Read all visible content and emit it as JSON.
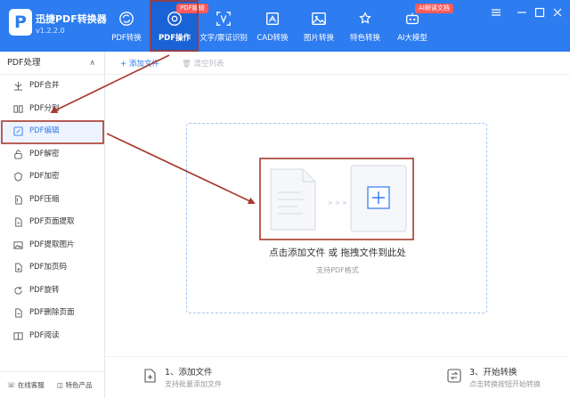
{
  "app": {
    "logo_glyph": "P",
    "name": "迅捷PDF转换器",
    "version": "v1.2.2.0"
  },
  "nav": {
    "tabs": [
      {
        "label": "PDF转换",
        "icon": "refresh-icon",
        "active": false
      },
      {
        "label": "PDF操作",
        "icon": "settings-target-icon",
        "active": true,
        "badge": "PDF编辑"
      },
      {
        "label": "文字/票证识别",
        "icon": "scan-frame-icon",
        "active": false
      },
      {
        "label": "CAD转换",
        "icon": "cad-drawing-icon",
        "active": false
      },
      {
        "label": "图片转换",
        "icon": "image-icon",
        "active": false
      },
      {
        "label": "特色转换",
        "icon": "star-refresh-icon",
        "active": false
      },
      {
        "label": "AI大模型",
        "icon": "robot-icon",
        "active": false,
        "badge": "AI解读文档"
      }
    ]
  },
  "window_controls": [
    "menu-icon",
    "minimize-icon",
    "maximize-icon",
    "close-icon"
  ],
  "sidebar": {
    "header": "PDF处理",
    "items": [
      {
        "label": "PDF合并",
        "icon": "merge-icon"
      },
      {
        "label": "PDF分割",
        "icon": "split-icon"
      },
      {
        "label": "PDF编辑",
        "icon": "edit-icon",
        "active": true
      },
      {
        "label": "PDF解密",
        "icon": "unlock-icon"
      },
      {
        "label": "PDF加密",
        "icon": "shield-icon"
      },
      {
        "label": "PDF压缩",
        "icon": "compress-icon"
      },
      {
        "label": "PDF页面提取",
        "icon": "page-extract-icon"
      },
      {
        "label": "PDF提取图片",
        "icon": "extract-image-icon"
      },
      {
        "label": "PDF加页码",
        "icon": "page-number-icon"
      },
      {
        "label": "PDF旋转",
        "icon": "rotate-icon"
      },
      {
        "label": "PDF删除页面",
        "icon": "delete-page-icon"
      },
      {
        "label": "PDF阅读",
        "icon": "book-icon"
      }
    ],
    "footer": {
      "online_help": "在线客服",
      "featured": "特色产品"
    }
  },
  "toolbar": {
    "add_file": "添加文件",
    "clear_list": "清空列表"
  },
  "dropzone": {
    "arrows": "> > >",
    "main_text": "点击添加文件 或 拖拽文件到此处",
    "sub_text": "支持PDF格式"
  },
  "steps": [
    {
      "title": "1、添加文件",
      "desc": "支持批量添加文件",
      "icon": "add-file-icon"
    },
    {
      "title": "3、开始转换",
      "desc": "点击转换按钮开始转换",
      "icon": "convert-icon"
    }
  ],
  "colors": {
    "primary": "#2d7cf0",
    "annotation_red": "#a8382c",
    "badge_red": "#ff5a5a"
  }
}
